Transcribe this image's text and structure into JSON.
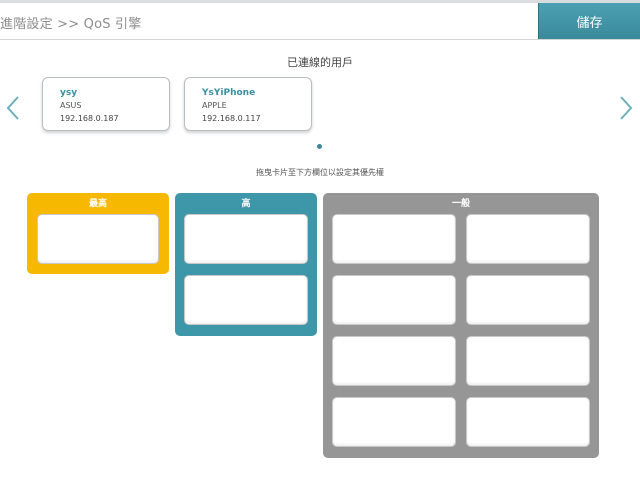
{
  "header": {
    "breadcrumb": "進階設定 >> QoS 引擎",
    "save_label": "儲存"
  },
  "connected": {
    "title": "已連線的用戶",
    "devices": [
      {
        "name": "ysy",
        "vendor": "ASUS",
        "ip": "192.168.0.187"
      },
      {
        "name": "YsYiPhone",
        "vendor": "APPLE",
        "ip": "192.168.0.117"
      }
    ]
  },
  "hint": "拖曳卡片至下方欄位以設定其優先權",
  "priority": {
    "highest_label": "最高",
    "high_label": "高",
    "normal_label": "一般"
  },
  "colors": {
    "accent": "#3e97a9",
    "highest": "#f6b800",
    "high": "#3e97a9",
    "normal": "#969696"
  },
  "icons": {
    "left": "chevron-left-icon",
    "right": "chevron-right-icon"
  }
}
